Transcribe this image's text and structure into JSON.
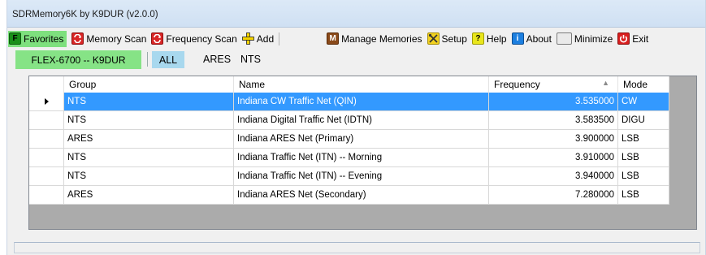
{
  "window": {
    "title": "SDRMemory6K by K9DUR (v2.0.0)"
  },
  "toolbar": {
    "favorites": {
      "icon_text": "F",
      "label": "Favorites",
      "icon": "favorites-icon"
    },
    "memory_scan": {
      "label": "Memory Scan",
      "icon": "scan-loop-icon"
    },
    "frequency_scan": {
      "label": "Frequency Scan",
      "icon": "scan-loop-icon"
    },
    "add": {
      "label": "Add",
      "icon": "plus-icon"
    },
    "manage_memories": {
      "icon_text": "M",
      "label": "Manage Memories",
      "icon": "manage-icon"
    },
    "setup": {
      "label": "Setup",
      "icon": "tools-icon"
    },
    "help": {
      "icon_text": "?",
      "label": "Help",
      "icon": "help-icon"
    },
    "about": {
      "icon_text": "i",
      "label": "About",
      "icon": "info-icon"
    },
    "minimize": {
      "label": "Minimize",
      "icon": "minimize-icon"
    },
    "exit": {
      "label": "Exit",
      "icon": "power-icon"
    }
  },
  "radio": {
    "label": "FLEX-6700 -- K9DUR"
  },
  "filters": {
    "all": "ALL",
    "ares": "ARES",
    "nts": "NTS"
  },
  "grid": {
    "headers": {
      "group": "Group",
      "name": "Name",
      "frequency": "Frequency",
      "mode": "Mode"
    },
    "sort": {
      "column": "frequency",
      "direction": "ascending"
    },
    "rows": [
      {
        "group": "NTS",
        "name": "Indiana CW Traffic Net (QIN)",
        "frequency": "3.535000",
        "mode": "CW",
        "selected": true
      },
      {
        "group": "NTS",
        "name": "Indiana Digital Traffic Net (IDTN)",
        "frequency": "3.583500",
        "mode": "DIGU"
      },
      {
        "group": "ARES",
        "name": "Indiana ARES Net (Primary)",
        "frequency": "3.900000",
        "mode": "LSB"
      },
      {
        "group": "NTS",
        "name": "Indiana Traffic Net (ITN) -- Morning",
        "frequency": "3.910000",
        "mode": "LSB"
      },
      {
        "group": "NTS",
        "name": "Indiana Traffic Net (ITN) -- Evening",
        "frequency": "3.940000",
        "mode": "LSB"
      },
      {
        "group": "ARES",
        "name": "Indiana ARES Net (Secondary)",
        "frequency": "7.280000",
        "mode": "LSB"
      }
    ]
  },
  "colors": {
    "favorites_bg": "#7ee07e",
    "radio_tab_bg": "#86e386",
    "filter_all_bg": "#a8d8ee",
    "selection": "#3399ff",
    "grid_empty": "#ababab"
  }
}
